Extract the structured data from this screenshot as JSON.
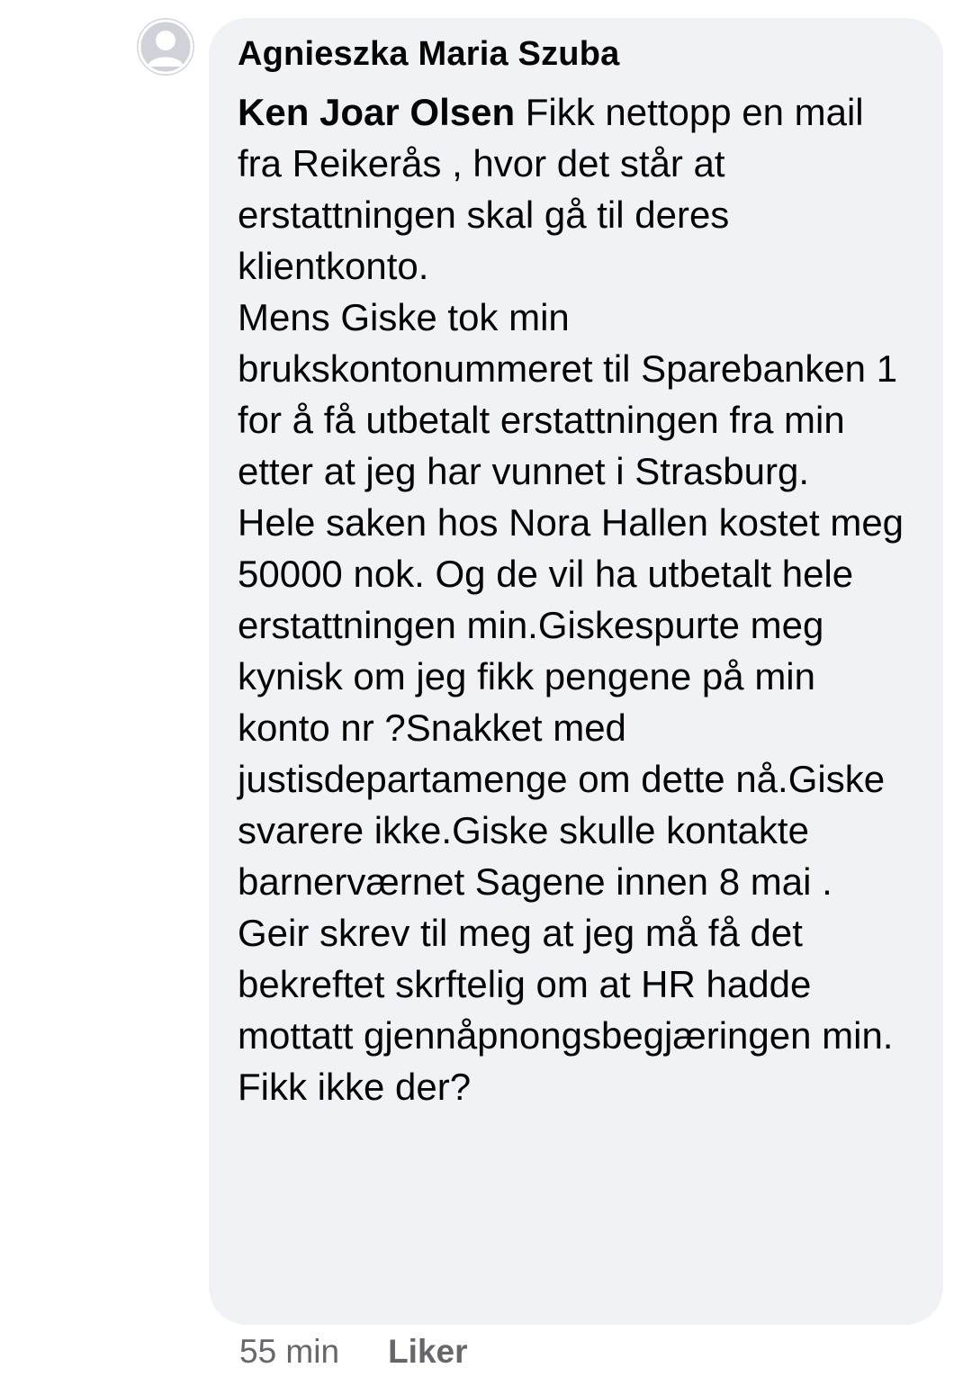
{
  "comment": {
    "author": "Agnieszka Maria Szuba",
    "mention": "Ken Joar Olsen",
    "text": " Fikk nettopp en mail fra Reikerås , hvor det står at erstattningen skal gå til deres klientkonto.\nMens Giske tok min brukskontonummeret til Sparebanken 1 for å få utbetalt erstattningen fra min etter at jeg har vunnet i Strasburg.\nHele saken hos Nora Hallen kostet meg 50000 nok. Og de vil ha utbetalt hele erstattningen min.Giskespurte meg kynisk om jeg fikk pengene på min konto nr ?Snakket med justisdepartamenge om dette nå.Giske svarere ikke.Giske skulle kontakte barnerværnet Sagene innen 8 mai .\nGeir skrev til meg at jeg må få det bekreftet skrftelig om at HR hadde mottatt gjennåpnongsbegjæringen min. Fikk ikke der?",
    "avatar_icon": "default-profile-avatar-icon"
  },
  "actions": {
    "timestamp": "55 min",
    "like_label": "Liker"
  },
  "colors": {
    "bubble_background": "#f0f2f5",
    "text": "#050505",
    "secondary_text": "#65676b",
    "avatar_background": "#cfd3d9"
  }
}
